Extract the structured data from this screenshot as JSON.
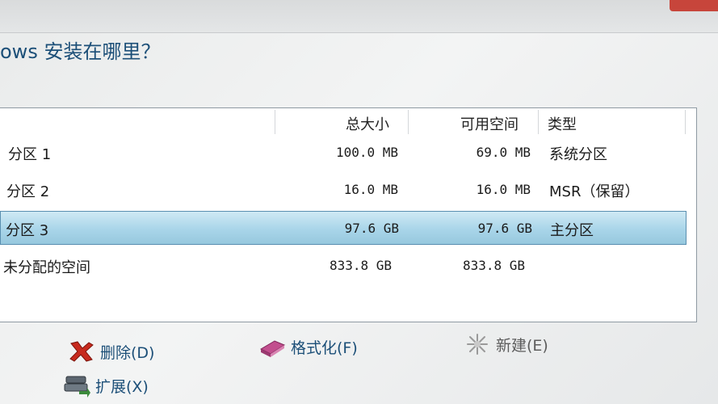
{
  "prompt": {
    "title": "ows  安装在哪里？"
  },
  "table": {
    "columns": {
      "total": "总大小",
      "free": "可用空间",
      "type": "类型"
    },
    "rows": [
      {
        "name": "分区 1",
        "total": "100.0 MB",
        "free": "69.0 MB",
        "type": "系统分区"
      },
      {
        "name": "分区 2",
        "total": "16.0 MB",
        "free": "16.0 MB",
        "type": "MSR（保留）"
      },
      {
        "name": "分区 3",
        "total": "97.6 GB",
        "free": "97.6 GB",
        "type": "主分区"
      },
      {
        "name": "未分配的空间",
        "total": "833.8 GB",
        "free": "833.8 GB",
        "type": ""
      }
    ],
    "selected_row": 2
  },
  "actions": {
    "delete": "删除(D)",
    "format": "格式化(F)",
    "new": "新建(E)",
    "extend": "扩展(X)"
  },
  "colors": {
    "accent": "#1c4f78",
    "selection": "#a9d5e9",
    "close": "#c7453b"
  },
  "icons": {
    "delete": "red-x-icon",
    "format": "eraser-icon",
    "new": "sparkle-icon",
    "extend": "drive-stack-icon"
  }
}
